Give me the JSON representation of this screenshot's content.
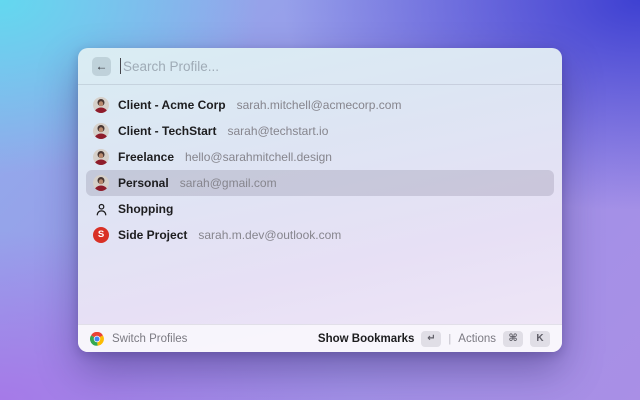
{
  "search": {
    "placeholder": "Search Profile..."
  },
  "back_button": {
    "glyph": "←"
  },
  "profiles": [
    {
      "name": "Client - Acme Corp",
      "email": "sarah.mitchell@acmecorp.com",
      "avatar": "woman-photo",
      "selected": false
    },
    {
      "name": "Client - TechStart",
      "email": "sarah@techstart.io",
      "avatar": "woman-photo",
      "selected": false
    },
    {
      "name": "Freelance",
      "email": "hello@sarahmitchell.design",
      "avatar": "woman-photo",
      "selected": false
    },
    {
      "name": "Personal",
      "email": "sarah@gmail.com",
      "avatar": "woman-photo",
      "selected": true
    },
    {
      "name": "Shopping",
      "email": "",
      "avatar": "person-outline",
      "selected": false
    },
    {
      "name": "Side Project",
      "email": "sarah.m.dev@outlook.com",
      "avatar": "letter-badge",
      "letter": "S",
      "selected": false
    }
  ],
  "footer": {
    "app_icon": "chrome-logo",
    "left_label": "Switch Profiles",
    "primary_action": "Show Bookmarks",
    "primary_key": "↵",
    "divider": "|",
    "secondary_action": "Actions",
    "secondary_keys": [
      "⌘",
      "K"
    ]
  },
  "colors": {
    "bg_top_left": "#63d8ef",
    "bg_top_right": "#3b3ed1",
    "bg_bottom_left": "#a678e8",
    "bg_bottom_right": "#a98fe6",
    "selected_row": "rgba(122,118,145,0.25)",
    "avatar_shirt_red": "#8e1c2b",
    "side_project_red": "#d93025",
    "chrome_red": "#EA4335",
    "chrome_yellow": "#FBBC05",
    "chrome_green": "#34A853",
    "chrome_blue": "#4285F4"
  }
}
